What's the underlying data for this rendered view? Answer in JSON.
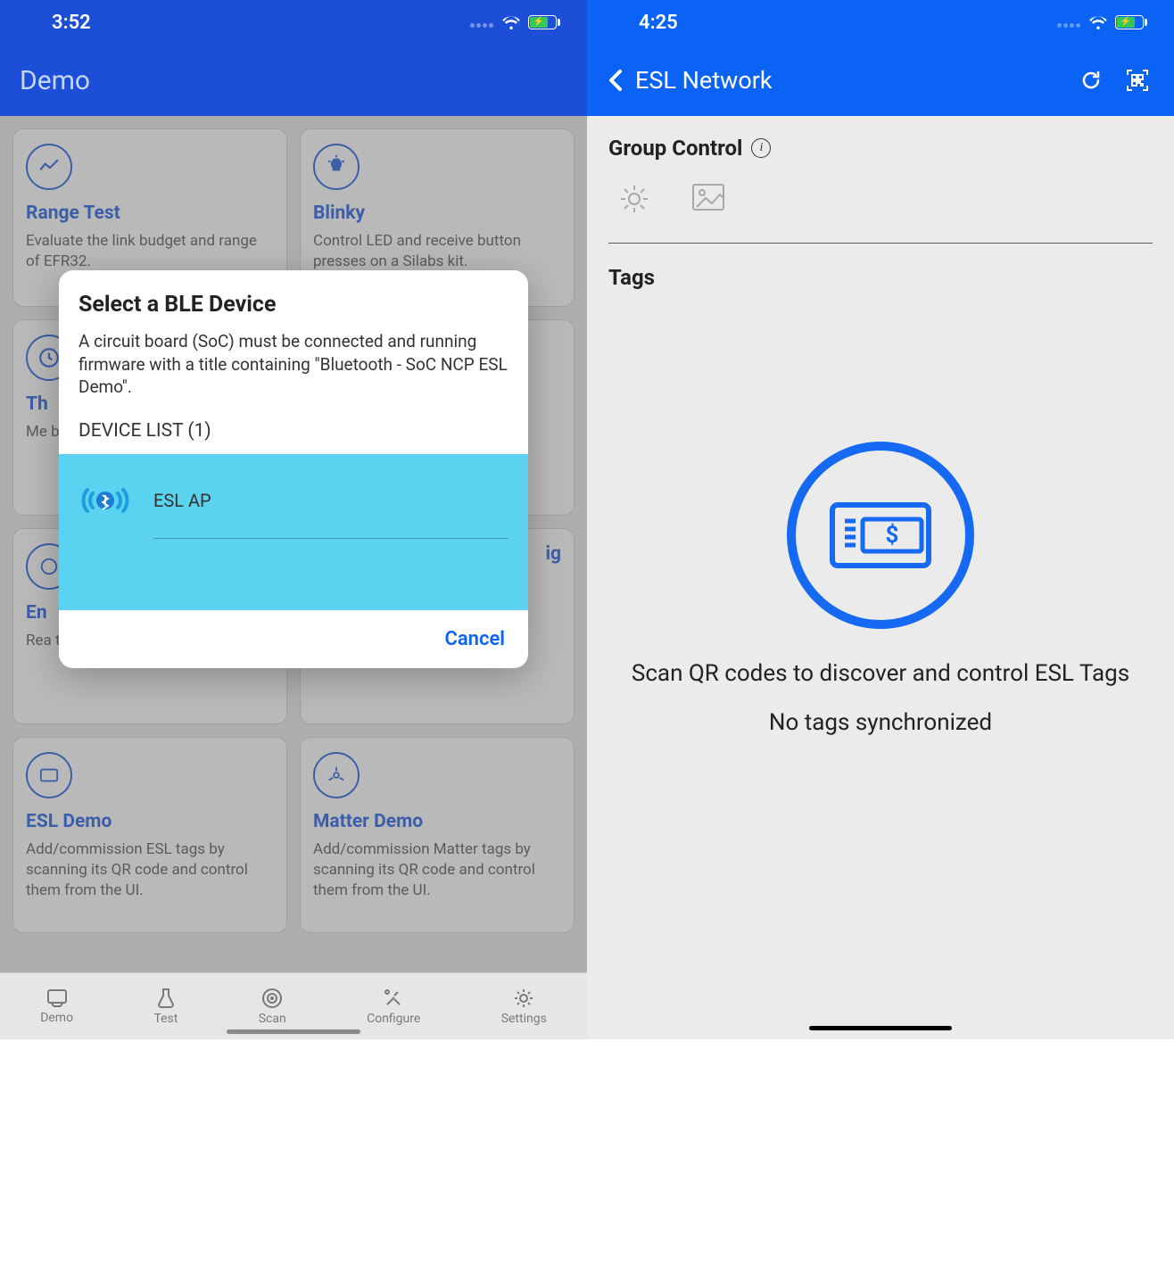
{
  "left": {
    "status_time": "3:52",
    "page_title": "Demo",
    "cards": [
      {
        "title": "Range Test",
        "desc": "Evaluate the link budget and range of EFR32."
      },
      {
        "title": "Blinky",
        "desc": "Control LED and receive button presses on a Silabs kit."
      },
      {
        "title": "Th",
        "desc": "Me bet anc"
      },
      {
        "title": "",
        "desc": ""
      },
      {
        "title": "En",
        "desc": "Rea the"
      },
      {
        "title": "ig",
        "desc": ""
      },
      {
        "title": "ESL Demo",
        "desc": "Add/commission ESL tags by scanning its QR code and control them from the UI."
      },
      {
        "title": "Matter Demo",
        "desc": "Add/commission Matter tags by scanning its QR code and control them from the UI."
      }
    ],
    "modal": {
      "title": "Select a BLE Device",
      "desc": "A circuit board (SoC) must be connected and running firmware with a title containing \"Bluetooth - SoC NCP ESL Demo\".",
      "list_label": "DEVICE LIST (1)",
      "devices": [
        {
          "name": "ESL AP"
        }
      ],
      "cancel": "Cancel"
    },
    "tabs": [
      {
        "label": "Demo"
      },
      {
        "label": "Test"
      },
      {
        "label": "Scan"
      },
      {
        "label": "Configure"
      },
      {
        "label": "Settings"
      }
    ]
  },
  "right": {
    "status_time": "4:25",
    "nav_title": "ESL Network",
    "group_title": "Group Control",
    "tags_title": "Tags",
    "scan_line": "Scan QR codes to discover and control ESL Tags",
    "sync_line": "No tags synchronized"
  }
}
